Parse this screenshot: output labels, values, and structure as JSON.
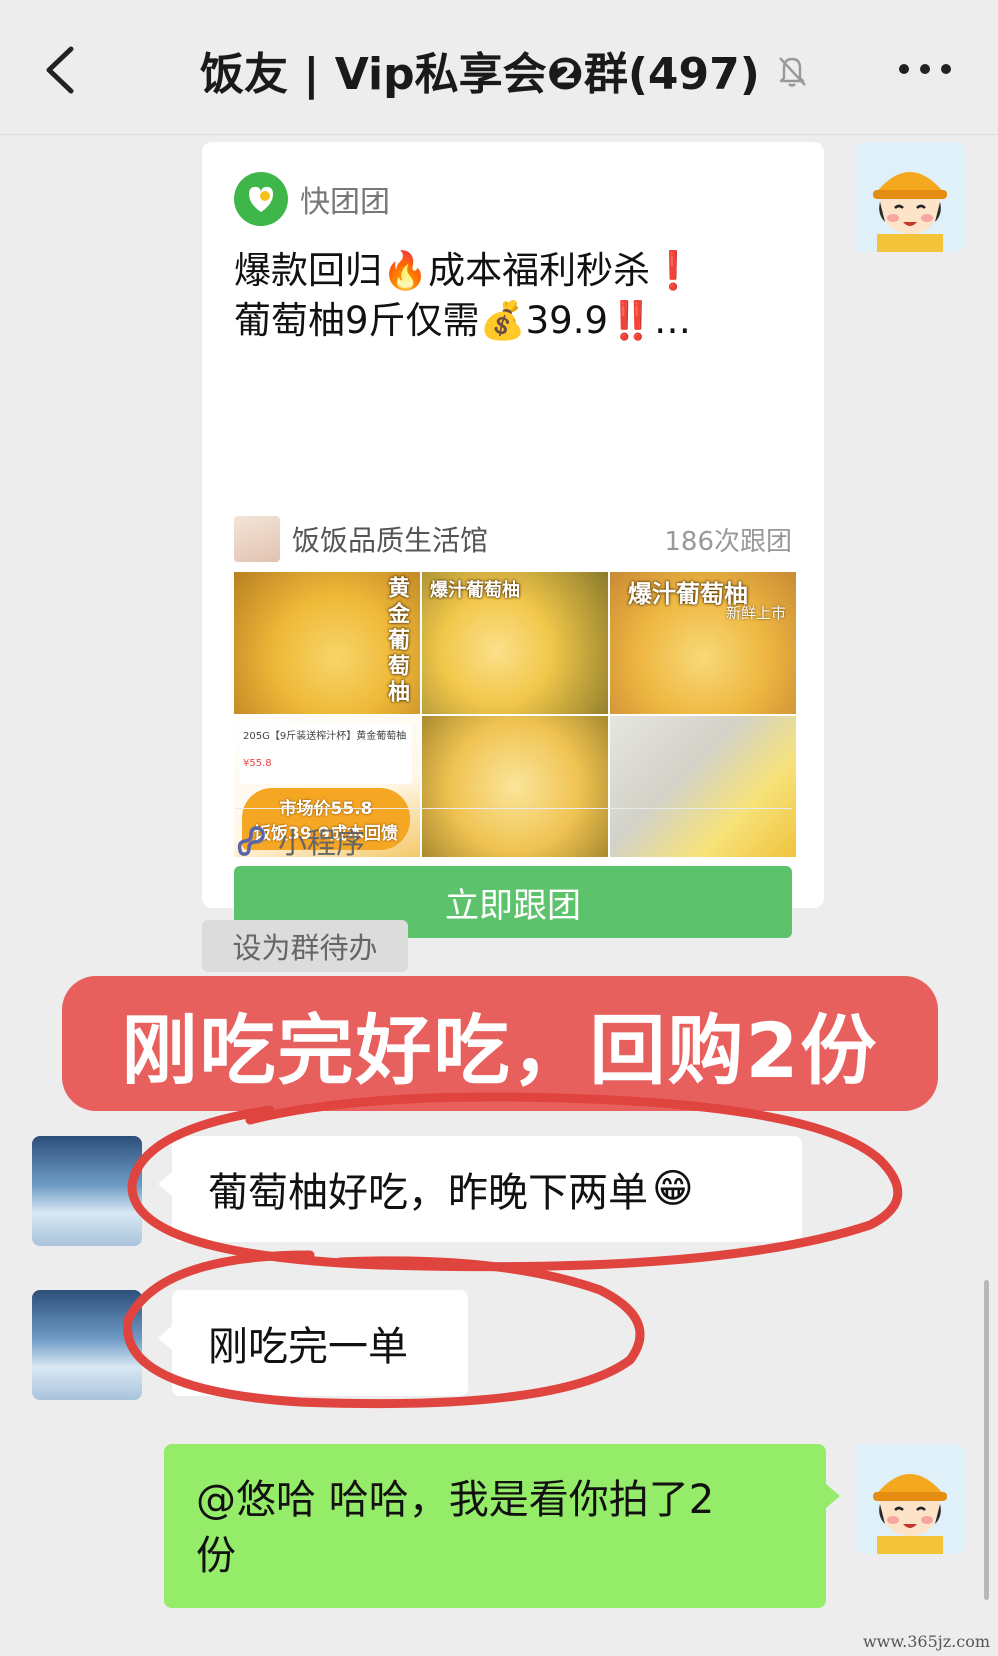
{
  "header": {
    "title": "饭友 | Vip私享会❷群(497)",
    "back_icon": "chevron-left-icon",
    "mute_icon": "bell-off-icon",
    "more_icon": "more-dots-icon"
  },
  "card": {
    "brand_name": "快团团",
    "title_line1": "爆款回归🔥成本福利秒杀❗",
    "title_line2": "葡萄柚9斤仅需💰39.9‼️…",
    "store_name": "饭饭品质生活馆",
    "follow_count": "186次跟团",
    "photos": {
      "p1_label": "黄金葡萄柚",
      "p2_label": "爆汁葡萄柚",
      "p3_label": "爆汁葡萄柚",
      "p3_sublabel": "新鲜上市",
      "p4_mini_title": "205G【9斤装送榨汁杯】黄金葡萄柚",
      "p4_mini_price": "¥55.8",
      "p4_tag_line1": "市场价55.8",
      "p4_tag_line2": "饭饭39.9成本回馈"
    },
    "join_button": "立即跟团",
    "footer_label": "小程序"
  },
  "todo_chip": "设为群待办",
  "banner_text": "刚吃完好吃，回购2份",
  "messages": [
    {
      "text": "葡萄柚好吃，昨晚下两单",
      "emoji": "😁"
    },
    {
      "text": "刚吃完一单"
    },
    {
      "text_line1": "@悠哈 哈哈，我是看你拍了2",
      "text_line2": "份"
    }
  ],
  "watermark": "www.365jz.com",
  "colors": {
    "background": "#ededed",
    "join_button": "#5cc26b",
    "banner": "#e8605e",
    "own_bubble": "#95ec69",
    "scribble": "#e0443e"
  }
}
